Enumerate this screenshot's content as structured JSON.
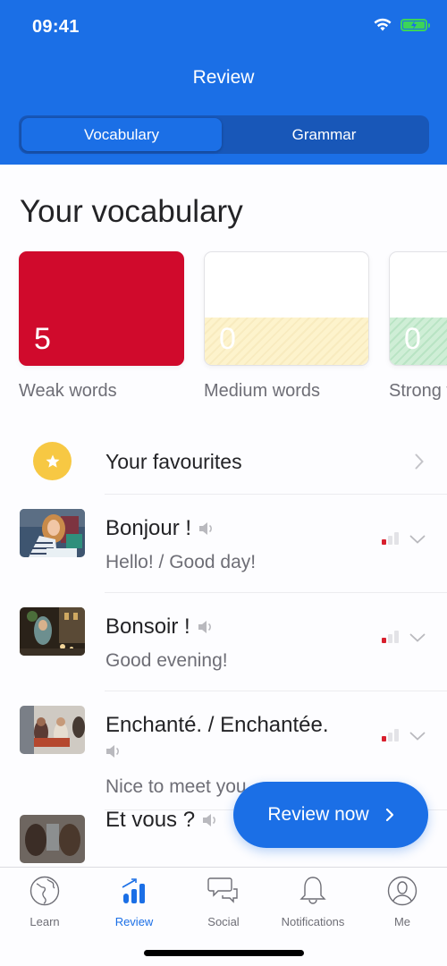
{
  "status_bar": {
    "time": "09:41",
    "icons": [
      "wifi-icon",
      "battery-charging-icon"
    ]
  },
  "header": {
    "title": "Review",
    "segments": [
      {
        "label": "Vocabulary",
        "active": true
      },
      {
        "label": "Grammar",
        "active": false
      }
    ]
  },
  "vocabulary": {
    "title": "Your vocabulary",
    "cards": [
      {
        "label": "Weak words",
        "count": "5",
        "color": "#d00a2c"
      },
      {
        "label": "Medium words",
        "count": "0",
        "color": "#fdf3cc"
      },
      {
        "label": "Strong words",
        "count": "0",
        "color": "#cfeed6"
      }
    ]
  },
  "favourites": {
    "label": "Your favourites",
    "icon": "star-icon",
    "accent": "#f7c843"
  },
  "words": [
    {
      "word": "Bonjour !",
      "translation": "Hello! / Good day!",
      "strength_bars": 1,
      "thumb": "woman-smiling-photo"
    },
    {
      "word": "Bonsoir !",
      "translation": "Good evening!",
      "strength_bars": 1,
      "thumb": "evening-street-photo"
    },
    {
      "word": "Enchanté. / Enchantée.",
      "translation": "Nice to meet you",
      "strength_bars": 1,
      "thumb": "people-meeting-photo"
    },
    {
      "word": "Et vous ?",
      "translation": "",
      "strength_bars": 1,
      "thumb": "two-people-photo"
    }
  ],
  "fab": {
    "label": "Review now"
  },
  "tabbar": {
    "items": [
      {
        "label": "Learn",
        "icon": "globe-icon",
        "active": false
      },
      {
        "label": "Review",
        "icon": "chart-icon",
        "active": true
      },
      {
        "label": "Social",
        "icon": "chat-icon",
        "active": false
      },
      {
        "label": "Notifications",
        "icon": "bell-icon",
        "active": false
      },
      {
        "label": "Me",
        "icon": "profile-icon",
        "active": false
      }
    ]
  },
  "colors": {
    "primary": "#1b6fe6",
    "weak": "#d00a2c",
    "star": "#f7c843"
  }
}
